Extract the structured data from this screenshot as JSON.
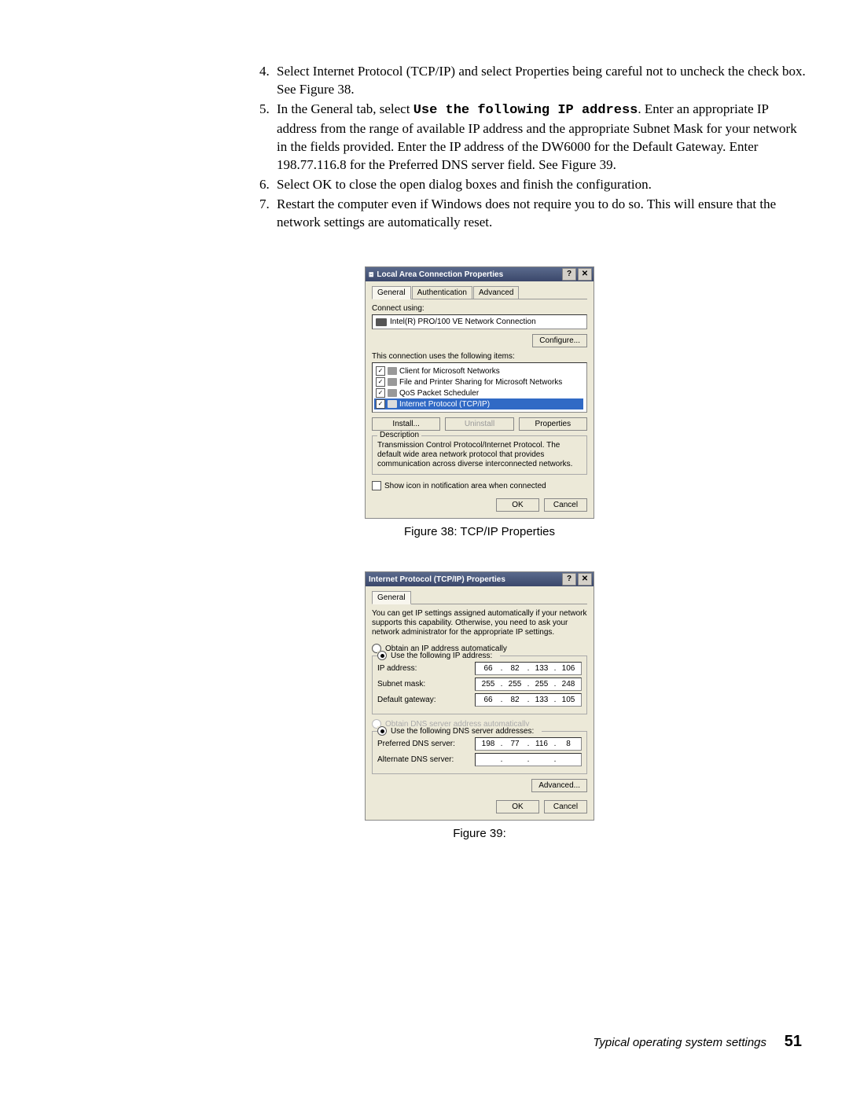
{
  "steps": [
    {
      "n": "4.",
      "text_a": "Select Internet Protocol (TCP/IP) and select Properties being careful not to uncheck the check box. See Figure 38."
    },
    {
      "n": "5.",
      "text_a": "In the General tab, select ",
      "mono": "Use the following IP address",
      "text_b": ". Enter an appropriate IP address from the range of available IP address and the appropriate Subnet Mask for your network in the fields provided. Enter the IP address of the DW6000 for the Default Gateway. Enter 198.77.116.8 for the Preferred DNS server field. See Figure 39."
    },
    {
      "n": "6.",
      "text_a": "Select OK to close the open dialog boxes and finish the configuration."
    },
    {
      "n": "7.",
      "text_a": "Restart the computer even if Windows does not require you to do so. This will ensure that the network settings are automatically reset."
    }
  ],
  "fig38": {
    "caption": "Figure 38:  TCP/IP Properties",
    "title": "Local Area Connection Properties",
    "tabs": [
      "General",
      "Authentication",
      "Advanced"
    ],
    "connect_using_label": "Connect using:",
    "nic": "Intel(R) PRO/100 VE Network Connection",
    "configure": "Configure...",
    "items_label": "This connection uses the following items:",
    "items": [
      "Client for Microsoft Networks",
      "File and Printer Sharing for Microsoft Networks",
      "QoS Packet Scheduler",
      "Internet Protocol (TCP/IP)"
    ],
    "install": "Install...",
    "uninstall": "Uninstall",
    "properties": "Properties",
    "description_label": "Description",
    "description": "Transmission Control Protocol/Internet Protocol. The default wide area network protocol that provides communication across diverse interconnected networks.",
    "show_icon": "Show icon in notification area when connected",
    "ok": "OK",
    "cancel": "Cancel"
  },
  "fig39": {
    "caption": "Figure 39:",
    "title": "Internet Protocol (TCP/IP) Properties",
    "tab": "General",
    "info": "You can get IP settings assigned automatically if your network supports this capability. Otherwise, you need to ask your network administrator for the appropriate IP settings.",
    "radio_auto_ip": "Obtain an IP address automatically",
    "radio_use_ip": "Use the following IP address:",
    "ip_label": "IP address:",
    "ip_value": [
      "66",
      "82",
      "133",
      "106"
    ],
    "mask_label": "Subnet mask:",
    "mask_value": [
      "255",
      "255",
      "255",
      "248"
    ],
    "gw_label": "Default gateway:",
    "gw_value": [
      "66",
      "82",
      "133",
      "105"
    ],
    "radio_auto_dns": "Obtain DNS server address automatically",
    "radio_use_dns": "Use the following DNS server addresses:",
    "pref_dns_label": "Preferred DNS server:",
    "pref_dns_value": [
      "198",
      "77",
      "116",
      "8"
    ],
    "alt_dns_label": "Alternate DNS server:",
    "alt_dns_value": [
      "",
      "",
      "",
      ""
    ],
    "advanced": "Advanced...",
    "ok": "OK",
    "cancel": "Cancel"
  },
  "footer": {
    "label": "Typical operating system settings",
    "page": "51"
  }
}
